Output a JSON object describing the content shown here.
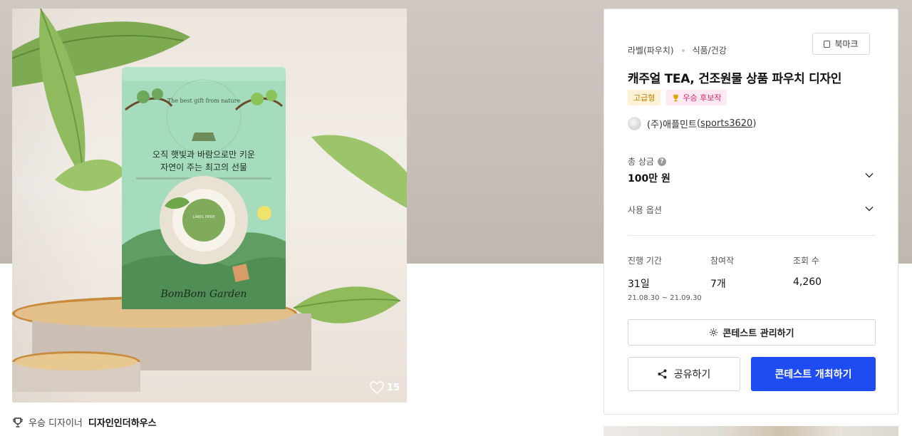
{
  "product_image": {
    "like_count": "15",
    "pack_text": {
      "arc": "The best gift from nature",
      "headline_1": "오직 햇빛과 바람으로만 키운",
      "headline_2": "자연이 주는 최고의 선물",
      "label_1": "LABEL HERE",
      "brand": "BomBom Garden"
    }
  },
  "winner_line": {
    "prefix": "우승 디자이너",
    "name": "디자인인더하우스"
  },
  "panel": {
    "breadcrumb": [
      "라벨(파우치)",
      "식품/건강"
    ],
    "bookmark_label": "북마크",
    "title": "캐주얼 TEA, 건조원물 상품 파우치 디자인",
    "badges": {
      "premium": "고급형",
      "winner": "우승 후보작"
    },
    "owner": {
      "company": "(주)애플민트",
      "handle": "sports3620"
    },
    "prize": {
      "label": "총 상금",
      "help": "?",
      "value": "100만 원"
    },
    "options_label": "사용 옵션",
    "stats": [
      {
        "label": "진행 기간",
        "value": "31일",
        "sub": "21.08.30 ~ 21.09.30"
      },
      {
        "label": "참여작",
        "value": "7개",
        "sub": ""
      },
      {
        "label": "조회 수",
        "value": "4,260",
        "sub": ""
      }
    ],
    "buttons": {
      "manage": "콘테스트 관리하기",
      "share": "공유하기",
      "host": "콘테스트 개최하기"
    }
  },
  "colors": {
    "primary": "#1f4bf2",
    "premium_badge_bg": "#fff2d6",
    "premium_badge_text": "#c47f00",
    "winner_badge_bg": "#ffe9f3",
    "winner_badge_text": "#d6226b",
    "pouch_green": "#9fd6b6"
  }
}
